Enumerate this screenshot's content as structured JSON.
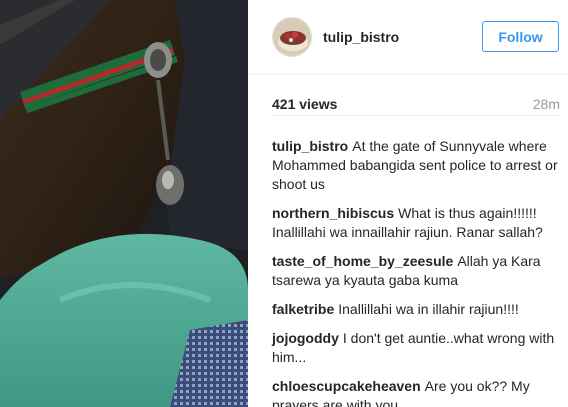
{
  "header": {
    "username": "tulip_bistro",
    "follow_label": "Follow"
  },
  "stats": {
    "views": "421 views",
    "time": "28m"
  },
  "comments": [
    {
      "author": "tulip_bistro",
      "text": "At the gate of Sunnyvale where Mohammed babangida sent police to arrest or shoot us"
    },
    {
      "author": "northern_hibiscus",
      "text": "What is thus again!!!!!! Inallillahi wa innaillahir rajiun. Ranar sallah?"
    },
    {
      "author": "taste_of_home_by_zeesule",
      "text": "Allah ya Kara tsarewa ya kyauta gaba kuma"
    },
    {
      "author": "falketribe",
      "text": "Inallillahi wa in illahir rajiun!!!!"
    },
    {
      "author": "jojogoddy",
      "text": "I don't get auntie..what wrong with him..."
    },
    {
      "author": "chloescupcakeheaven",
      "text": "Are you ok?? My prayers are with you"
    }
  ],
  "colors": {
    "accent": "#3897f0",
    "muted": "#999999",
    "text": "#262626"
  }
}
